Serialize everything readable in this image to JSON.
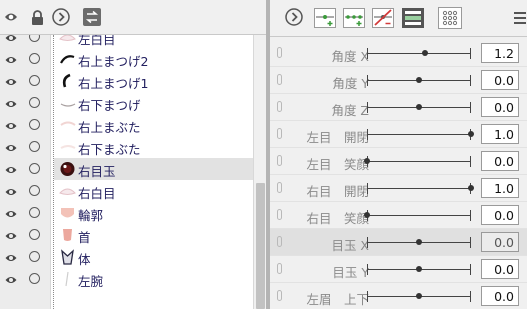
{
  "layers": [
    {
      "name": "左白目",
      "thumb": "eye-white",
      "selected": false
    },
    {
      "name": "右上まつげ2",
      "thumb": "lash-arc",
      "selected": false
    },
    {
      "name": "右上まつげ1",
      "thumb": "lash-curl",
      "selected": false
    },
    {
      "name": "右下まつげ",
      "thumb": "lower-lash",
      "selected": false
    },
    {
      "name": "右上まぶた",
      "thumb": "lid",
      "selected": false
    },
    {
      "name": "右下まぶた",
      "thumb": "lid-faint",
      "selected": false
    },
    {
      "name": "右目玉",
      "thumb": "eyeball",
      "selected": true
    },
    {
      "name": "右白目",
      "thumb": "eye-white",
      "selected": false
    },
    {
      "name": "輪郭",
      "thumb": "face",
      "selected": false
    },
    {
      "name": "首",
      "thumb": "neck",
      "selected": false
    },
    {
      "name": "体",
      "thumb": "body",
      "selected": false
    },
    {
      "name": "左腕",
      "thumb": "arm",
      "selected": false
    }
  ],
  "parameters": [
    {
      "label": "角度 X",
      "value": "1.2",
      "pos": 0.56,
      "highlighted": false
    },
    {
      "label": "角度 Y",
      "value": "0.0",
      "pos": 0.5,
      "highlighted": false
    },
    {
      "label": "角度 Z",
      "value": "0.0",
      "pos": 0.5,
      "highlighted": false
    },
    {
      "label": "左目　開閉",
      "value": "1.0",
      "pos": 1.0,
      "highlighted": false
    },
    {
      "label": "左目　笑顔",
      "value": "0.0",
      "pos": 0.0,
      "highlighted": false
    },
    {
      "label": "右目　開閉",
      "value": "1.0",
      "pos": 1.0,
      "highlighted": false
    },
    {
      "label": "右目　笑顔",
      "value": "0.0",
      "pos": 0.0,
      "highlighted": false
    },
    {
      "label": "目玉 X",
      "value": "0.0",
      "pos": 0.5,
      "highlighted": true
    },
    {
      "label": "目玉 Y",
      "value": "0.0",
      "pos": 0.5,
      "highlighted": false
    },
    {
      "label": "左眉　上下",
      "value": "0.0",
      "pos": 0.5,
      "highlighted": false
    }
  ],
  "colors": {
    "accent_green": "#3a9a3a",
    "delete_red": "#d23b3b",
    "layer_text": "#232060",
    "param_label": "#8a8a8a"
  },
  "icons": {
    "left_toolbar": [
      "eye-icon",
      "lock-icon",
      "chevron-right-icon",
      "swap-icon"
    ],
    "right_toolbar": [
      "chevron-right-icon",
      "add-key-icon",
      "add-keys-icon",
      "delete-key-icon",
      "view-icon",
      "grid-icon",
      "menu-icon"
    ]
  }
}
